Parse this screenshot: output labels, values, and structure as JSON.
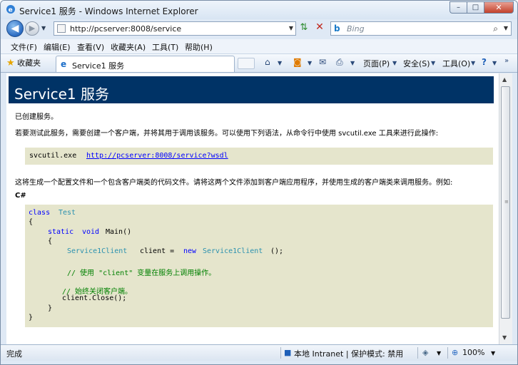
{
  "window": {
    "title": "Service1 服务 - Windows Internet Explorer",
    "min_glyph": "–",
    "max_glyph": "□",
    "close_glyph": "✕"
  },
  "nav": {
    "address": "http://pcserver:8008/service",
    "search_placeholder": "Bing"
  },
  "menu": [
    "文件(F)",
    "编辑(E)",
    "查看(V)",
    "收藏夹(A)",
    "工具(T)",
    "帮助(H)"
  ],
  "favorites": {
    "label": "收藏夹"
  },
  "tab": {
    "title": "Service1 服务"
  },
  "commands": {
    "page": "页面(P)",
    "safety": "安全(S)",
    "tools": "工具(O)"
  },
  "page": {
    "heading": "Service1 服务",
    "p1": "已创建服务。",
    "p2": "若要测试此服务，需要创建一个客户端，并将其用于调用该服务。可以使用下列语法，从命令行中使用 svcutil.exe 工具来进行此操作:",
    "cmd": "svcutil.exe",
    "wsdl": "http://pcserver:8008/service?wsdl",
    "p3": "这将生成一个配置文件和一个包含客户端类的代码文件。请将这两个文件添加到客户端应用程序，并使用生成的客户端类来调用服务。例如:",
    "lang": "C#",
    "code": {
      "l1_kw": "class",
      "l1_ty": "Test",
      "l2": "{",
      "l3_kw1": "static",
      "l3_kw2": "void",
      "l3_rest": "Main()",
      "l4": "{",
      "l5_ty1": "Service1Client",
      "l5_mid": "client =",
      "l5_kw": "new",
      "l5_ty2": "Service1Client",
      "l5_end": "();",
      "l6": "// 使用 \"client\" 变量在服务上调用操作。",
      "l7": "// 始终关闭客户端。",
      "l8": "client.Close();",
      "l9": "}",
      "l10": "}"
    }
  },
  "status": {
    "text": "完成",
    "zone": "本地 Intranet | 保护模式: 禁用",
    "zoom": "100%"
  }
}
